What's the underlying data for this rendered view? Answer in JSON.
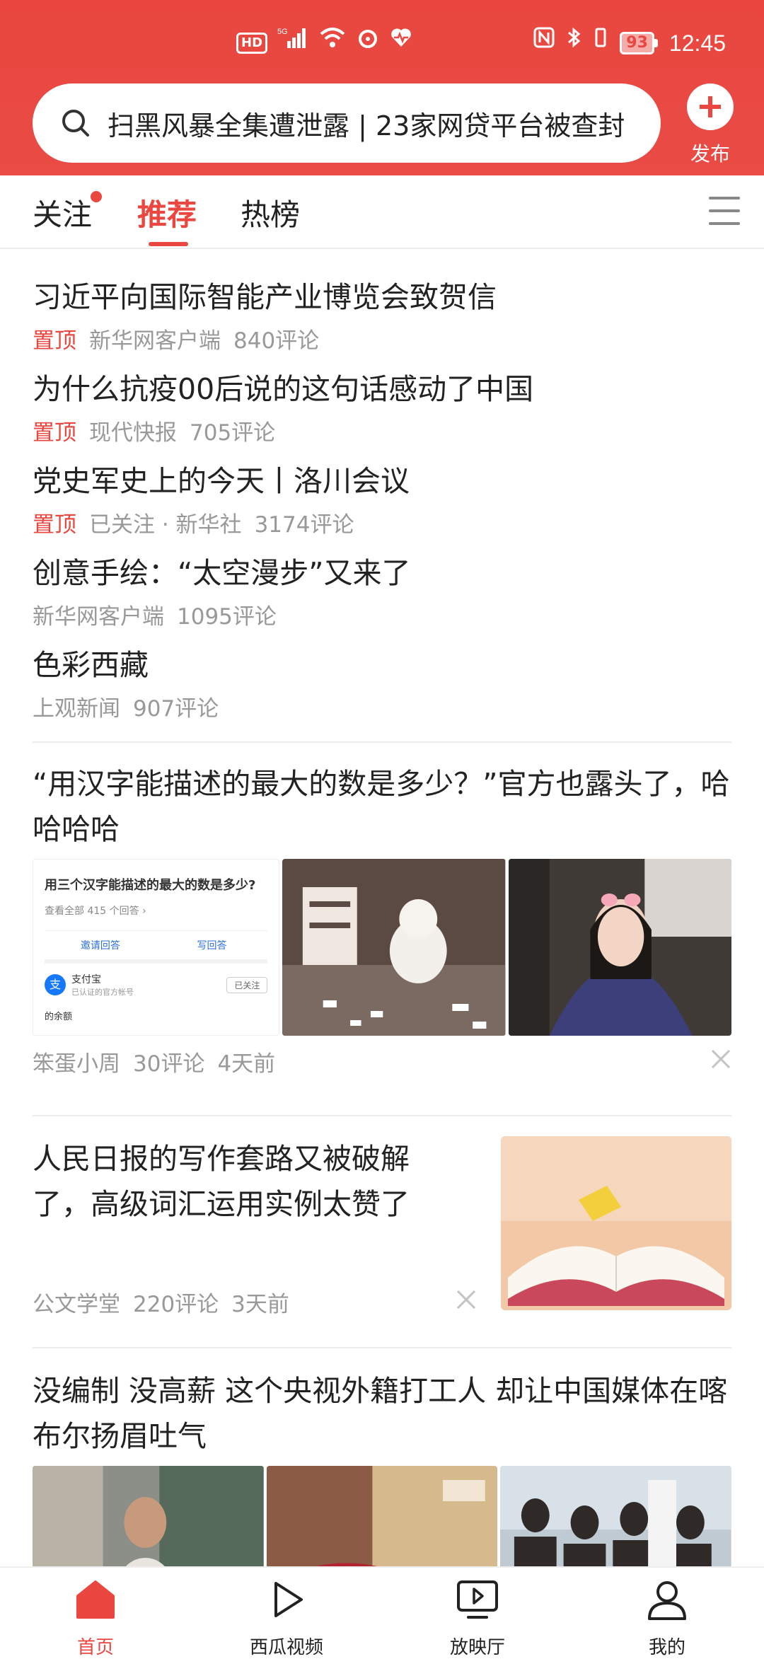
{
  "status_bar": {
    "left_icons": [
      "hd-icon",
      "5g-signal-icon",
      "wifi-icon",
      "sync-icon",
      "health-icon"
    ],
    "hd_label": "HD",
    "battery": "93",
    "time": "12:45"
  },
  "header": {
    "search_text": "扫黑风暴全集遭泄露 | 23家网贷平台被查封",
    "publish_label": "发布"
  },
  "tabs": [
    {
      "label": "关注",
      "has_dot": true
    },
    {
      "label": "推荐",
      "active": true
    },
    {
      "label": "热榜"
    }
  ],
  "pinned": [
    {
      "title": "习近平向国际智能产业博览会致贺信",
      "pin": "置顶",
      "source": "新华网客户端",
      "comments": "840评论"
    },
    {
      "title": "为什么抗疫00后说的这句话感动了中国",
      "pin": "置顶",
      "source": "现代快报",
      "comments": "705评论"
    },
    {
      "title": "党史军史上的今天丨洛川会议",
      "pin": "置顶",
      "source": "已关注 · 新华社",
      "comments": "3174评论"
    },
    {
      "title": "创意手绘：“太空漫步”又来了",
      "source": "新华网客户端",
      "comments": "1095评论"
    },
    {
      "title": "色彩西藏",
      "source": "上观新闻",
      "comments": "907评论"
    }
  ],
  "article1": {
    "title": "“用汉字能描述的最大的数是多少？”官方也露头了，哈哈哈哈",
    "thumb_text": {
      "question": "用三个汉字能描述的最大的数是多少?",
      "view_all": "查看全部 415 个回答 ›",
      "invite": "邀请回答",
      "write": "写回答",
      "account": "支付宝",
      "account_sub": "已认证的官方帐号",
      "follow": "已关注",
      "balance": "的余额"
    },
    "author": "笨蛋小周",
    "comments": "30评论",
    "time": "4天前"
  },
  "article2": {
    "title": "人民日报的写作套路又被破解了，高级词汇运用实例太赞了",
    "author": "公文学堂",
    "comments": "220评论",
    "time": "3天前"
  },
  "article3": {
    "title": "没编制 没高薪 这个央视外籍打工人 却让中国媒体在喀布尔扬眉吐气"
  },
  "bottom_nav": [
    {
      "label": "首页",
      "icon": "home-icon",
      "active": true
    },
    {
      "label": "西瓜视频",
      "icon": "play-icon"
    },
    {
      "label": "放映厅",
      "icon": "screen-play-icon"
    },
    {
      "label": "我的",
      "icon": "profile-icon"
    }
  ],
  "colors": {
    "accent": "#e9473f",
    "meta": "#999999"
  }
}
